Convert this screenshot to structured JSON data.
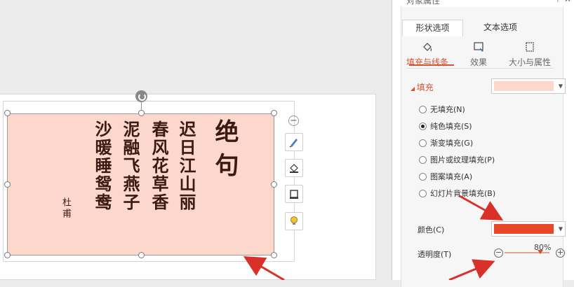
{
  "panel": {
    "title": "对象属性",
    "header_icons": "⊤ ✕",
    "tabs": [
      "形状选项",
      "文本选项"
    ],
    "active_tab": 0,
    "subtabs": [
      {
        "label": "填充与线条",
        "icon": "paint-bucket-icon"
      },
      {
        "label": "效果",
        "icon": "effects-icon"
      },
      {
        "label": "大小与属性",
        "icon": "size-properties-icon"
      }
    ],
    "section_title": "填充",
    "fill_swatch_color": "#fbd7cc",
    "fill_options": [
      "无填充(N)",
      "纯色填充(S)",
      "渐变填充(G)",
      "图片或纹理填充(P)",
      "图案填充(A)",
      "幻灯片背景填充(B)"
    ],
    "fill_selected": 1,
    "color_label": "颜色(C)",
    "color_value": "#e8472a",
    "transparency_label": "透明度(T)",
    "transparency_value": "80%",
    "transparency_fraction": 0.8,
    "minus": "−",
    "plus": "+"
  },
  "canvas": {
    "poem_columns": [
      "绝句",
      "迟日江山丽",
      "春风花草香",
      "泥融飞燕子",
      "沙暖睡鸳鸯"
    ],
    "author": "杜甫",
    "textbox_fill": "#fbd7cc",
    "float_tools": [
      "edit-shape-icon",
      "fill-icon",
      "outline-icon",
      "bulb-icon"
    ],
    "collapse": "−"
  },
  "colors": {
    "accent": "#d2552f",
    "arrow": "#d9302a"
  }
}
